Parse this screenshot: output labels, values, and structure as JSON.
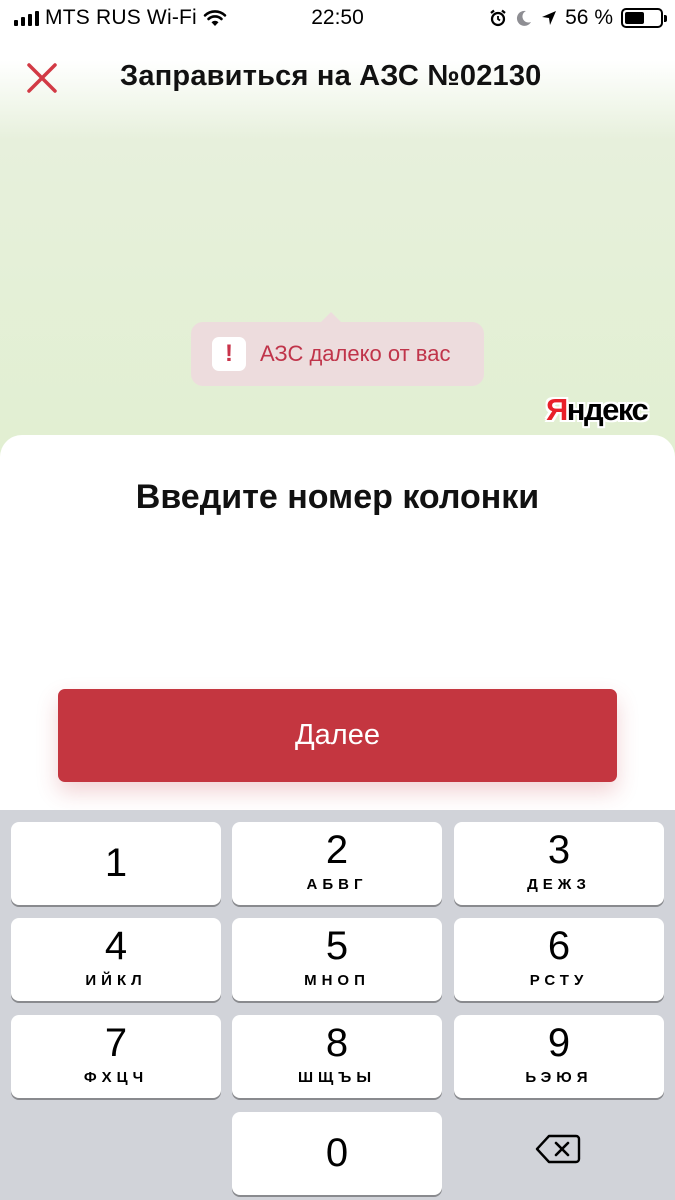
{
  "status_bar": {
    "carrier": "MTS RUS Wi-Fi",
    "time": "22:50",
    "battery_percent": "56 %",
    "battery_level": 0.56,
    "icons": [
      "signal-icon",
      "wifi-icon",
      "alarm-icon",
      "moon-icon",
      "location-icon",
      "battery-icon"
    ]
  },
  "header": {
    "title": "Заправиться на АЗС №02130",
    "close_icon": "close-icon",
    "accent_color": "#d23a45"
  },
  "map": {
    "warning_icon": "!",
    "warning_text": "АЗС далеко от вас",
    "logo_first": "Я",
    "logo_rest": "ндекс"
  },
  "sheet": {
    "title": "Введите номер колонки",
    "next_button": "Далее",
    "button_color": "#c43640"
  },
  "keypad": {
    "keys": [
      {
        "digit": "1",
        "letters": ""
      },
      {
        "digit": "2",
        "letters": "АБВГ"
      },
      {
        "digit": "3",
        "letters": "ДЕЖЗ"
      },
      {
        "digit": "4",
        "letters": "ИЙКЛ"
      },
      {
        "digit": "5",
        "letters": "МНОП"
      },
      {
        "digit": "6",
        "letters": "РСТУ"
      },
      {
        "digit": "7",
        "letters": "ФХЦЧ"
      },
      {
        "digit": "8",
        "letters": "ШЩЪЫ"
      },
      {
        "digit": "9",
        "letters": "ЬЭЮЯ"
      },
      {
        "digit": "0",
        "letters": ""
      }
    ],
    "backspace_icon": "backspace-icon"
  }
}
